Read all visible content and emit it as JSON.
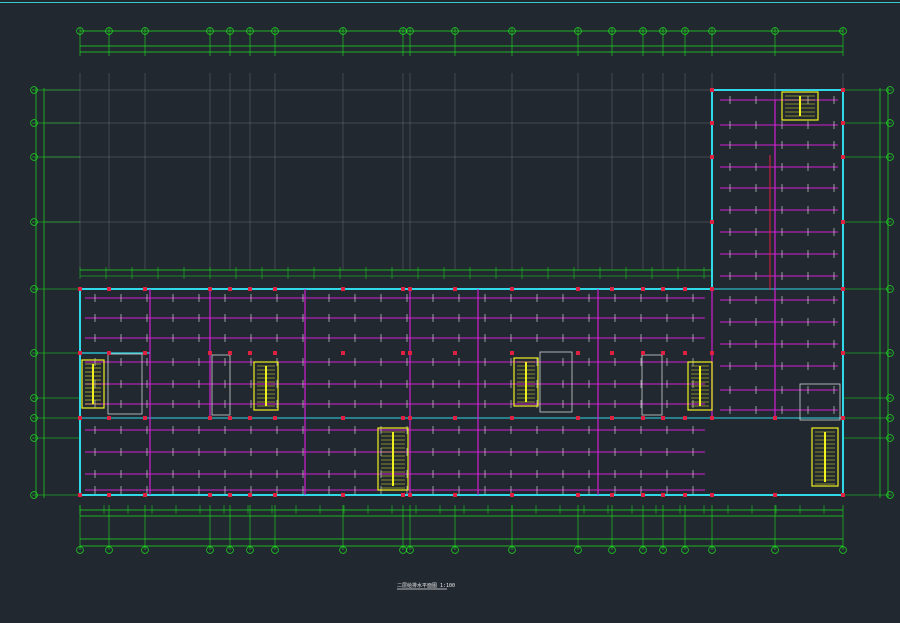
{
  "drawing": {
    "title": "二层给排水平面图 1:100",
    "colors": {
      "background": "#212830",
      "grid": "#6a6a70",
      "dimension": "#1fe01f",
      "wall": "#30d8e8",
      "pipe": "#d020d0",
      "stair": "#f0f020",
      "column": "#e02040",
      "text": "#e8e8e8"
    }
  }
}
